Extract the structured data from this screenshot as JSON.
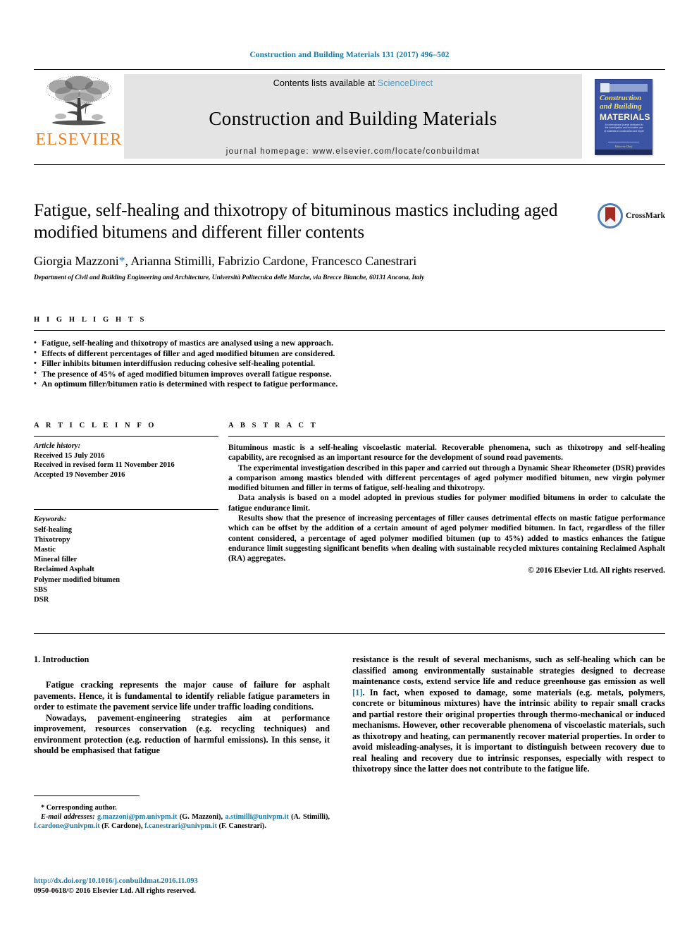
{
  "running_head": "Construction and Building Materials 131 (2017) 496–502",
  "masthead": {
    "publisher_name": "ELSEVIER",
    "contents_prefix": "Contents lists available at",
    "sciencedirect": "ScienceDirect",
    "journal_title": "Construction and Building Materials",
    "homepage": "journal homepage: www.elsevier.com/locate/conbuildmat",
    "cover": {
      "line1": "Construction",
      "line2": "and Building",
      "line3": "MATERIALS",
      "subtitle": "An international journal dedicated to the investigation and innovative use of materials in construction and repair",
      "footer": "Editor-in-Chief"
    }
  },
  "article": {
    "title": "Fatigue, self-healing and thixotropy of bituminous mastics including aged modified bitumens and different filler contents",
    "authors": "Giorgia Mazzoni",
    "corresponding_marker": "*",
    "authors_rest": ", Arianna Stimilli, Fabrizio Cardone, Francesco Canestrari",
    "affiliation": "Department of Civil and Building Engineering and Architecture, Università Politecnica delle Marche, via Brecce Bianche, 60131 Ancona, Italy",
    "crossmark_label": "CrossMark"
  },
  "highlights": {
    "label": "H I G H L I G H T S",
    "items": [
      "Fatigue, self-healing and thixotropy of mastics are analysed using a new approach.",
      "Effects of different percentages of filler and aged modified bitumen are considered.",
      "Filler inhibits bitumen interdiffusion reducing cohesive self-healing potential.",
      "The presence of 45% of aged modified bitumen improves overall fatigue response.",
      "An optimum filler/bitumen ratio is determined with respect to fatigue performance."
    ]
  },
  "article_info": {
    "label": "A R T I C L E    I N F O",
    "history_heading": "Article history:",
    "received": "Received 15 July 2016",
    "revised": "Received in revised form 11 November 2016",
    "accepted": "Accepted 19 November 2016",
    "keywords_heading": "Keywords:",
    "keywords": [
      "Self-healing",
      "Thixotropy",
      "Mastic",
      "Mineral filler",
      "Reclaimed Asphalt",
      "Polymer modified bitumen",
      "SBS",
      "DSR"
    ]
  },
  "abstract": {
    "label": "A B S T R A C T",
    "paragraphs": [
      "Bituminous mastic is a self-healing viscoelastic material. Recoverable phenomena, such as thixotropy and self-healing capability, are recognised as an important resource for the development of sound road pavements.",
      "The experimental investigation described in this paper and carried out through a Dynamic Shear Rheometer (DSR) provides a comparison among mastics blended with different percentages of aged polymer modified bitumen, new virgin polymer modified bitumen and filler in terms of fatigue, self-healing and thixotropy.",
      "Data analysis is based on a model adopted in previous studies for polymer modified bitumens in order to calculate the fatigue endurance limit.",
      "Results show that the presence of increasing percentages of filler causes detrimental effects on mastic fatigue performance which can be offset by the addition of a certain amount of aged polymer modified bitumen. In fact, regardless of the filler content considered, a percentage of aged polymer modified bitumen (up to 45%) added to mastics enhances the fatigue endurance limit suggesting significant benefits when dealing with sustainable recycled mixtures containing Reclaimed Asphalt (RA) aggregates."
    ],
    "copyright": "© 2016 Elsevier Ltd. All rights reserved."
  },
  "introduction": {
    "heading": "1. Introduction",
    "left_paragraphs": [
      "Fatigue cracking represents the major cause of failure for asphalt pavements. Hence, it is fundamental to identify reliable fatigue parameters in order to estimate the pavement service life under traffic loading conditions.",
      "Nowadays, pavement-engineering strategies aim at performance improvement, resources conservation (e.g. recycling techniques) and environment protection (e.g. reduction of harmful emissions). In this sense, it should be emphasised that fatigue"
    ],
    "right_text_before_cite": "resistance is the result of several mechanisms, such as self-healing which can be classified among environmentally sustainable strategies designed to decrease maintenance costs, extend service life and reduce greenhouse gas emission as well ",
    "citation": "[1]",
    "right_text_after_cite": ". In fact, when exposed to damage, some materials (e.g. metals, polymers, concrete or bituminous mixtures) have the intrinsic ability to repair small cracks and partial restore their original properties through thermo-mechanical or induced mechanisms. However, other recoverable phenomena of viscoelastic materials, such as thixotropy and heating, can permanently recover material properties. In order to avoid misleading-analyses, it is important to distinguish between recovery due to real healing and recovery due to intrinsic responses, especially with respect to thixotropy since the latter does not contribute to the fatigue life."
  },
  "footnotes": {
    "corresponding": "* Corresponding author.",
    "email_label": "E-mail addresses:",
    "emails": [
      {
        "address": "g.mazzoni@pm.univpm.it",
        "owner": "(G. Mazzoni),"
      },
      {
        "address": "a.stimilli@univpm.it",
        "owner": "(A. Stimilli),"
      },
      {
        "address": "f.cardone@univpm.it",
        "owner": "(F. Cardone),"
      },
      {
        "address": "f.canestrari@univpm.it",
        "owner": "(F. Canestrari)."
      }
    ],
    "doi": "http://dx.doi.org/10.1016/j.conbuildmat.2016.11.093",
    "issn_line": "0950-0618/© 2016 Elsevier Ltd. All rights reserved."
  },
  "colors": {
    "link_blue": "#1878a8",
    "sciencedirect_blue": "#3da0d7",
    "elsevier_orange": "#ef7d1a",
    "masthead_gray": "#e4e4e4",
    "cover_blue": "#3b55a4"
  }
}
